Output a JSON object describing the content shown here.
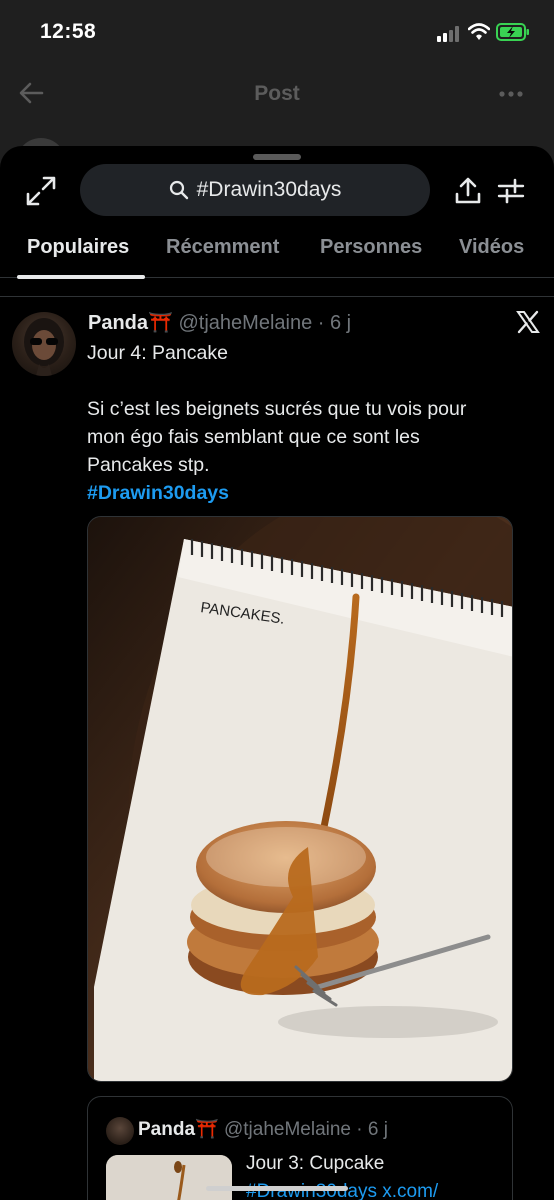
{
  "status_bar": {
    "time": "12:58"
  },
  "background": {
    "title": "Post"
  },
  "search": {
    "query": "#Drawin30days"
  },
  "tabs": [
    {
      "label": "Populaires",
      "active": true
    },
    {
      "label": "Récemment",
      "active": false
    },
    {
      "label": "Personnes",
      "active": false
    },
    {
      "label": "Vidéos",
      "active": false
    }
  ],
  "post": {
    "name": "Panda⛩️",
    "handle": "@tjaheMelaine",
    "time": "· 6 j",
    "lines": [
      "Jour 4: Pancake",
      "Si c’est les beignets sucrés que tu vois pour",
      "mon égo fais semblant que ce sont les",
      "Pancakes stp."
    ],
    "hashtag": "#Drawin30days",
    "image_caption": "PANCAKES."
  },
  "quoted_post": {
    "name": "Panda⛩️",
    "handle": "@tjaheMelaine",
    "time": "· 6 j",
    "text": "Jour 3: Cupcake",
    "link": "#Drawin30days x.com/"
  },
  "colors": {
    "accent": "#1d9bf0",
    "background": "#000000",
    "pill": "#202327"
  }
}
